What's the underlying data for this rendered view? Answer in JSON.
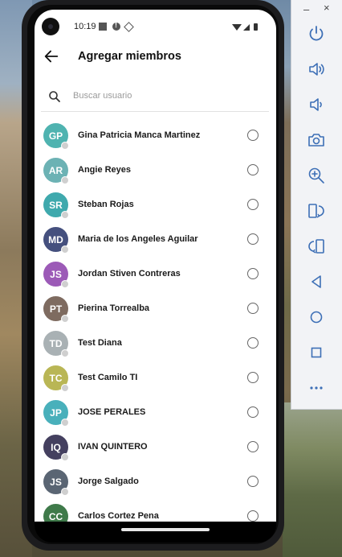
{
  "status_bar": {
    "time": "10:19"
  },
  "header": {
    "title": "Agregar miembros"
  },
  "search": {
    "placeholder": "Buscar usuario"
  },
  "members": [
    {
      "initials": "GP",
      "name": "Gina Patricia Manca Martinez",
      "color": "#4fb3b0"
    },
    {
      "initials": "AR",
      "name": "Angie Reyes",
      "color": "#6cb2b4"
    },
    {
      "initials": "SR",
      "name": "Steban Rojas",
      "color": "#3fa9ad"
    },
    {
      "initials": "MD",
      "name": "Maria de los Angeles Aguilar",
      "color": "#45507e"
    },
    {
      "initials": "JS",
      "name": "Jordan Stiven Contreras",
      "color": "#9c5ab7"
    },
    {
      "initials": "PT",
      "name": "Pierina Torrealba",
      "color": "#7e6b60"
    },
    {
      "initials": "TD",
      "name": "Test Diana",
      "color": "#a9b1b4"
    },
    {
      "initials": "TC",
      "name": "Test Camilo TI",
      "color": "#b9b655"
    },
    {
      "initials": "JP",
      "name": "JOSE PERALES",
      "color": "#49b0bb"
    },
    {
      "initials": "IQ",
      "name": "IVAN QUINTERO",
      "color": "#44405f"
    },
    {
      "initials": "JS",
      "name": "Jorge Salgado",
      "color": "#5a6573"
    },
    {
      "initials": "CC",
      "name": "Carlos Cortez Pena",
      "color": "#3f7a4a"
    }
  ],
  "emulator": {
    "minimize": "–",
    "close": "×"
  }
}
